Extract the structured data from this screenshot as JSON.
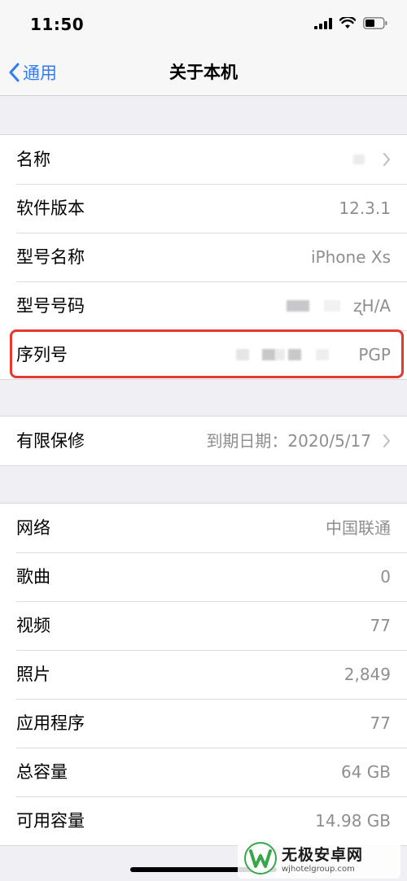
{
  "status": {
    "time": "11:50"
  },
  "nav": {
    "back_label": "通用",
    "title": "关于本机"
  },
  "group1": [
    {
      "label": "名称",
      "value": ""
    },
    {
      "label": "软件版本",
      "value": "12.3.1"
    },
    {
      "label": "型号名称",
      "value": "iPhone Xs"
    },
    {
      "label": "型号号码",
      "value": "ʐH/A"
    },
    {
      "label": "序列号",
      "value": "PGP"
    }
  ],
  "group2": [
    {
      "label": "有限保修",
      "value": "到期日期：2020/5/17"
    }
  ],
  "group3": [
    {
      "label": "网络",
      "value": "中国联通"
    },
    {
      "label": "歌曲",
      "value": "0"
    },
    {
      "label": "视频",
      "value": "77"
    },
    {
      "label": "照片",
      "value": "2,849"
    },
    {
      "label": "应用程序",
      "value": "77"
    },
    {
      "label": "总容量",
      "value": "64 GB"
    },
    {
      "label": "可用容量",
      "value": "14.98 GB"
    }
  ],
  "watermark": {
    "name": "无极安卓网",
    "url": "wjhotelgroup.com"
  },
  "colors": {
    "accent": "#2f7cf6",
    "highlight": "#e5392f",
    "value_gray": "#8e8e93"
  }
}
